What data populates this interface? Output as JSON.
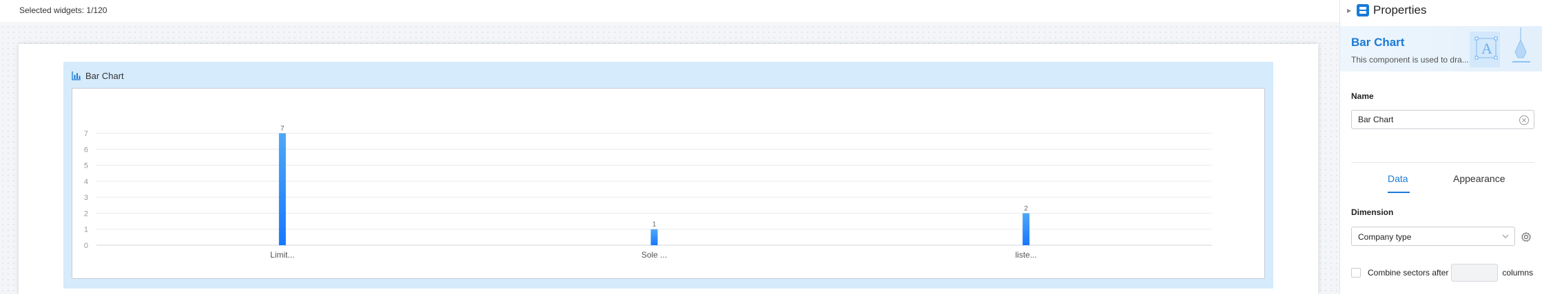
{
  "topbar": {
    "selected_widgets": "Selected widgets: 1/120"
  },
  "widget": {
    "title": "Bar Chart",
    "icon": "bar-chart-icon"
  },
  "chart_data": {
    "type": "bar",
    "categories": [
      "Limit...",
      "Sole ...",
      "liste..."
    ],
    "values": [
      7,
      1,
      2
    ],
    "data_labels": [
      "7",
      "1",
      "2"
    ],
    "yticks": [
      0,
      1,
      2,
      3,
      4,
      5,
      6,
      7
    ],
    "ylim": [
      0,
      7
    ],
    "grid": true,
    "colors": {
      "bar_top": "#4fa8f7",
      "bar_bottom": "#1677ff",
      "grid": "#e8eaed",
      "axis_text": "#999999"
    }
  },
  "panel": {
    "title": "Properties",
    "banner": {
      "title": "Bar Chart",
      "description": "This component is used to dra..."
    },
    "name_label": "Name",
    "name_value": "Bar Chart",
    "tabs": [
      {
        "label": "Data"
      },
      {
        "label": "Appearance"
      }
    ],
    "active_tab": "Data",
    "dimension_label": "Dimension",
    "dimension_value": "Company type",
    "combine_prefix": "Combine sectors after",
    "combine_suffix": "columns",
    "combine_checked": false
  },
  "colors": {
    "accent": "#1a7ad8",
    "widget_bg": "#d6ebfb"
  }
}
